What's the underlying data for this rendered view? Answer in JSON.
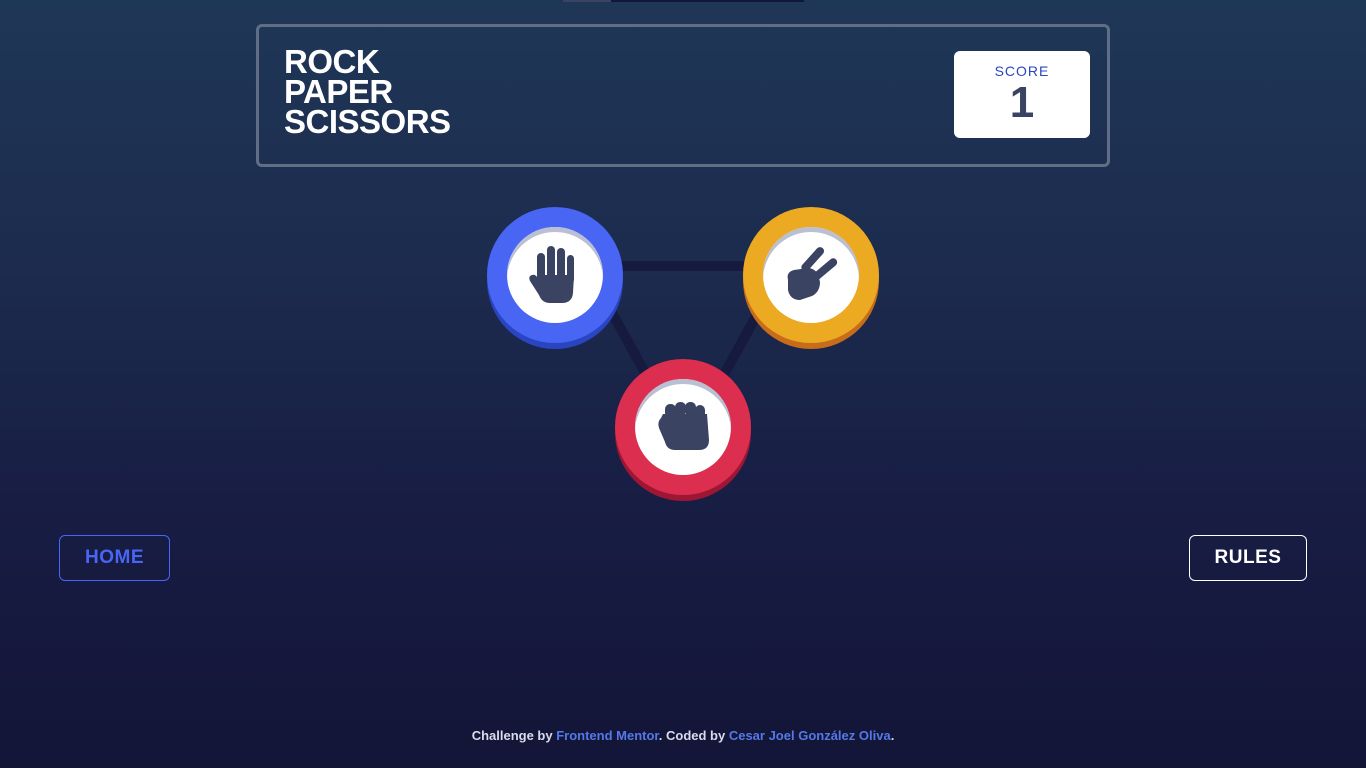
{
  "header": {
    "title_lines": [
      "ROCK",
      "PAPER",
      "SCISSORS"
    ],
    "score_label": "SCORE",
    "score_value": "1"
  },
  "tokens": [
    {
      "name": "paper",
      "icon": "paper-hand-icon",
      "color": "#4865f4",
      "shadow": "#2a45c2"
    },
    {
      "name": "scissors",
      "icon": "scissors-hand-icon",
      "color": "#eca922",
      "shadow": "#c76c1b"
    },
    {
      "name": "rock",
      "icon": "rock-fist-icon",
      "color": "#dc2e4e",
      "shadow": "#9d1634"
    }
  ],
  "buttons": {
    "home": "HOME",
    "rules": "RULES"
  },
  "footer": {
    "prefix": "Challenge by ",
    "link1": "Frontend Mentor",
    "middle": ". Coded by ",
    "link2": "Cesar Joel González Oliva",
    "suffix": "."
  },
  "colors": {
    "background_top": "#1f3757",
    "background_bottom": "#131537",
    "header_border": "#606e85",
    "score_label": "#2a46c0",
    "score_value": "#3b4363",
    "home_button": "#4865f4",
    "link": "#5578e8"
  }
}
